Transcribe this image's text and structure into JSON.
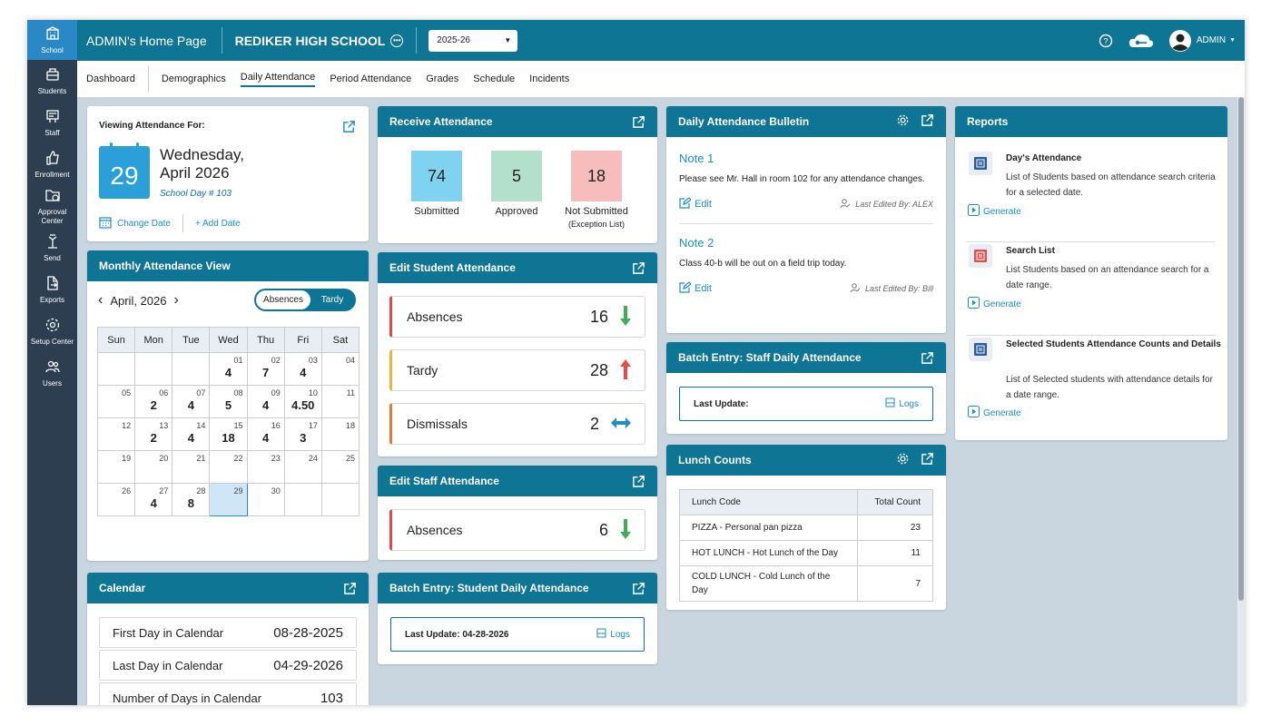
{
  "sidebar": {
    "items": [
      {
        "label": "School",
        "icon": "school-icon",
        "active": true
      },
      {
        "label": "Students",
        "icon": "students-icon"
      },
      {
        "label": "Staff",
        "icon": "staff-icon"
      },
      {
        "label": "Enrollment",
        "icon": "thumbs-up-icon"
      },
      {
        "label": "Approval Center",
        "icon": "approval-folder-icon"
      },
      {
        "label": "Send",
        "icon": "send-icon"
      },
      {
        "label": "Exports",
        "icon": "export-icon"
      },
      {
        "label": "Setup Center",
        "icon": "gear-icon"
      },
      {
        "label": "Users",
        "icon": "users-icon"
      }
    ]
  },
  "topbar": {
    "home_title": "ADMIN's Home Page",
    "school_name": "REDIKER HIGH SCHOOL",
    "year": "2025-26",
    "user": "ADMIN"
  },
  "tabs": [
    "Dashboard",
    "Demographics",
    "Daily Attendance",
    "Period Attendance",
    "Grades",
    "Schedule",
    "Incidents"
  ],
  "viewing": {
    "label": "Viewing Attendance For:",
    "day": "29",
    "weekday": "Wednesday,",
    "month_year": "April 2026",
    "school_day": "School Day # 103",
    "change_date": "Change Date",
    "add_date": "+ Add Date"
  },
  "monthly": {
    "title": "Monthly Attendance View",
    "month": "April, 2026",
    "toggle_absences": "Absences",
    "toggle_tardy": "Tardy",
    "weekdays": [
      "Sun",
      "Mon",
      "Tue",
      "Wed",
      "Thu",
      "Fri",
      "Sat"
    ],
    "weeks": [
      [
        [
          "",
          ""
        ],
        [
          "",
          ""
        ],
        [
          "",
          ""
        ],
        [
          "01",
          "4"
        ],
        [
          "02",
          "7"
        ],
        [
          "03",
          "4"
        ],
        [
          "04",
          ""
        ]
      ],
      [
        [
          "05",
          ""
        ],
        [
          "06",
          "2"
        ],
        [
          "07",
          "4"
        ],
        [
          "08",
          "5"
        ],
        [
          "09",
          "4"
        ],
        [
          "10",
          "4.50"
        ],
        [
          "11",
          ""
        ]
      ],
      [
        [
          "12",
          ""
        ],
        [
          "13",
          "2"
        ],
        [
          "14",
          "4"
        ],
        [
          "15",
          "18"
        ],
        [
          "16",
          "4"
        ],
        [
          "17",
          "3"
        ],
        [
          "18",
          ""
        ]
      ],
      [
        [
          "19",
          ""
        ],
        [
          "20",
          ""
        ],
        [
          "21",
          ""
        ],
        [
          "22",
          ""
        ],
        [
          "23",
          ""
        ],
        [
          "24",
          ""
        ],
        [
          "25",
          ""
        ]
      ],
      [
        [
          "26",
          ""
        ],
        [
          "27",
          "4"
        ],
        [
          "28",
          "8"
        ],
        [
          "29",
          ""
        ],
        [
          "30",
          ""
        ],
        [
          "",
          ""
        ],
        [
          "",
          ""
        ]
      ]
    ],
    "selected_day": "29"
  },
  "calendar": {
    "title": "Calendar",
    "rows": [
      {
        "label": "First Day in Calendar",
        "value": "08-28-2025"
      },
      {
        "label": "Last Day in Calendar",
        "value": "04-29-2026"
      },
      {
        "label": "Number of Days in Calendar",
        "value": "103"
      }
    ]
  },
  "receive": {
    "title": "Receive Attendance",
    "metrics": [
      {
        "value": "74",
        "label": "Submitted",
        "sub": "",
        "color": "#7fd3f0"
      },
      {
        "value": "5",
        "label": "Approved",
        "sub": "",
        "color": "#b3e0cd"
      },
      {
        "value": "18",
        "label": "Not Submitted",
        "sub": "(Exception List)",
        "color": "#f7bcbc"
      }
    ]
  },
  "edit_student": {
    "title": "Edit Student Attendance",
    "rows": [
      {
        "label": "Absences",
        "value": "16",
        "color": "#e0484d",
        "trend": "down"
      },
      {
        "label": "Tardy",
        "value": "28",
        "color": "#f0b43c",
        "trend": "up"
      },
      {
        "label": "Dismissals",
        "value": "2",
        "color": "#e57a2e",
        "trend": "flat"
      }
    ]
  },
  "edit_staff": {
    "title": "Edit Staff Attendance",
    "rows": [
      {
        "label": "Absences",
        "value": "6",
        "color": "#e0484d",
        "trend": "down"
      }
    ]
  },
  "batch_student": {
    "title": "Batch Entry: Student Daily Attendance",
    "last_update": "Last Update: 04-28-2026",
    "logs": "Logs"
  },
  "bulletin": {
    "title": "Daily Attendance Bulletin",
    "notes": [
      {
        "title": "Note 1",
        "text": "Please see Mr. Hall in room 102 for any attendance changes.",
        "edit": "Edit",
        "meta": "Last Edited By: ALEX"
      },
      {
        "title": "Note 2",
        "text": "Class 40-b will be out on a field trip today.",
        "edit": "Edit",
        "meta": "Last Edited By: Bill"
      }
    ]
  },
  "batch_staff": {
    "title": "Batch Entry: Staff Daily Attendance",
    "last_update": "Last Update:",
    "logs": "Logs"
  },
  "lunch": {
    "title": "Lunch Counts",
    "headers": [
      "Lunch Code",
      "Total Count"
    ],
    "rows": [
      {
        "code": "PIZZA - Personal pan pizza",
        "count": "23"
      },
      {
        "code": "HOT LUNCH - Hot Lunch of the Day",
        "count": "11"
      },
      {
        "code": "COLD LUNCH - Cold Lunch of the Day",
        "count": "7"
      }
    ]
  },
  "reports": {
    "title": "Reports",
    "items": [
      {
        "title": "Day's Attendance",
        "desc": "List of Students based on attendance search criteria for a selected date.",
        "generate": "Generate",
        "color": "#2a5d9f"
      },
      {
        "title": "Search List",
        "desc": "List Students based on an attendance search for a date range.",
        "generate": "Generate",
        "color": "#d9534f"
      },
      {
        "title": "Selected Students Attendance Counts and Details",
        "desc": "List of Selected students with attendance details for a date range.",
        "generate": "Generate",
        "color": "#2a5d9f"
      }
    ]
  }
}
